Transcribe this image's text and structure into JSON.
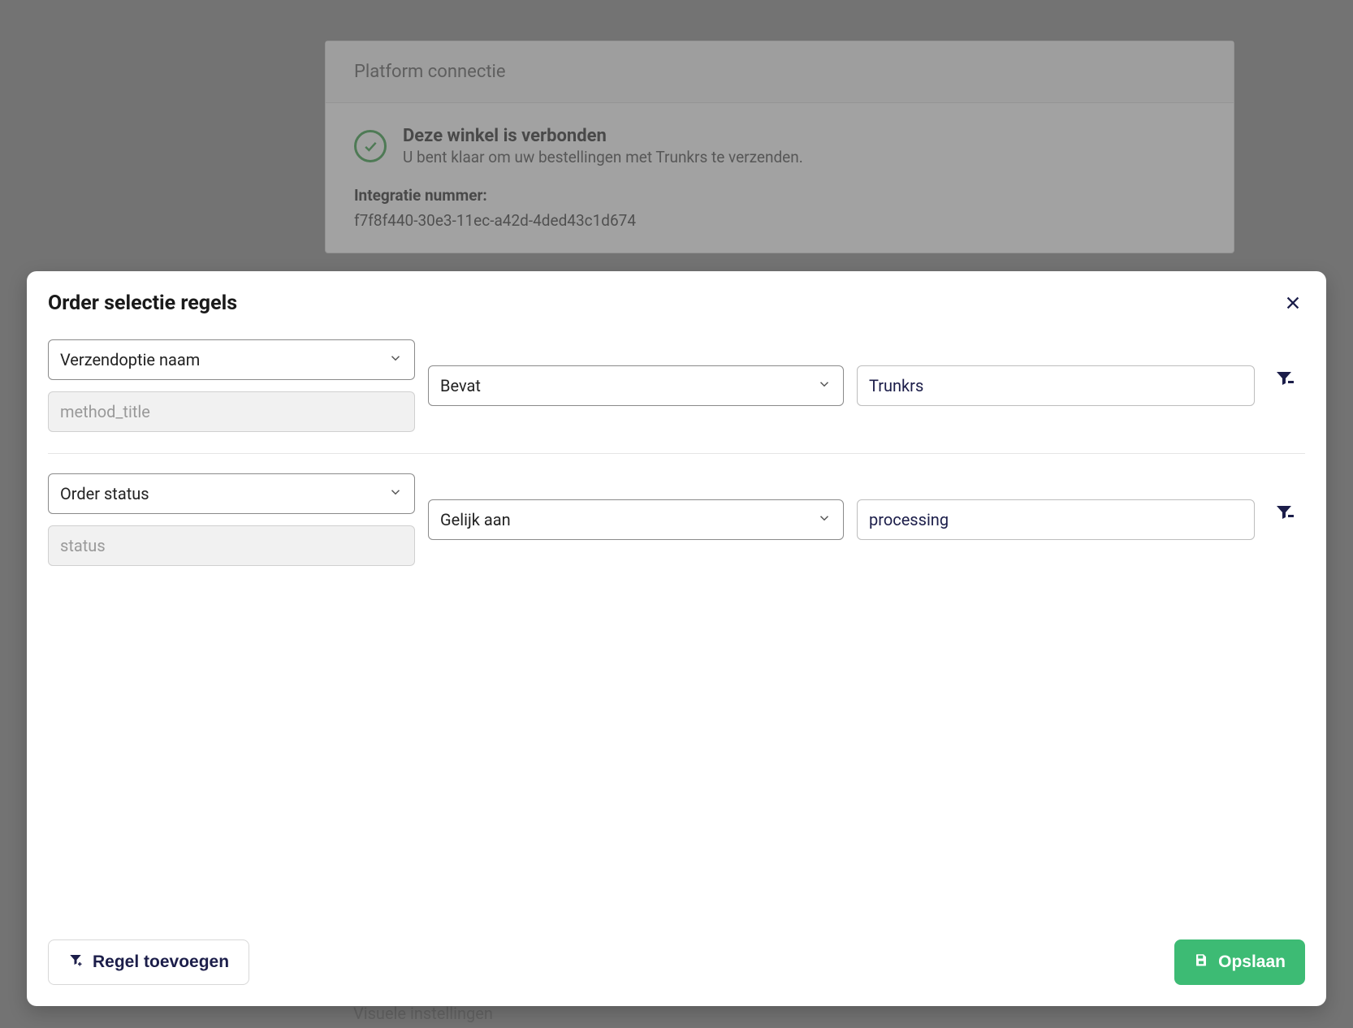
{
  "background": {
    "card_title": "Platform connectie",
    "connected_title": "Deze winkel is verbonden",
    "connected_subtitle": "U bent klaar om uw bestellingen met Trunkrs te verzenden.",
    "integration_label": "Integratie nummer:",
    "integration_value": "f7f8f440-30e3-11ec-a42d-4ded43c1d674",
    "below_text": "Visuele instellingen"
  },
  "modal": {
    "title": "Order selectie regels",
    "rules": [
      {
        "field_label": "Verzendoptie naam",
        "field_key": "method_title",
        "operator": "Bevat",
        "value": "Trunkrs"
      },
      {
        "field_label": "Order status",
        "field_key": "status",
        "operator": "Gelijk aan",
        "value": "processing"
      }
    ],
    "add_rule_label": "Regel toevoegen",
    "save_label": "Opslaan"
  }
}
